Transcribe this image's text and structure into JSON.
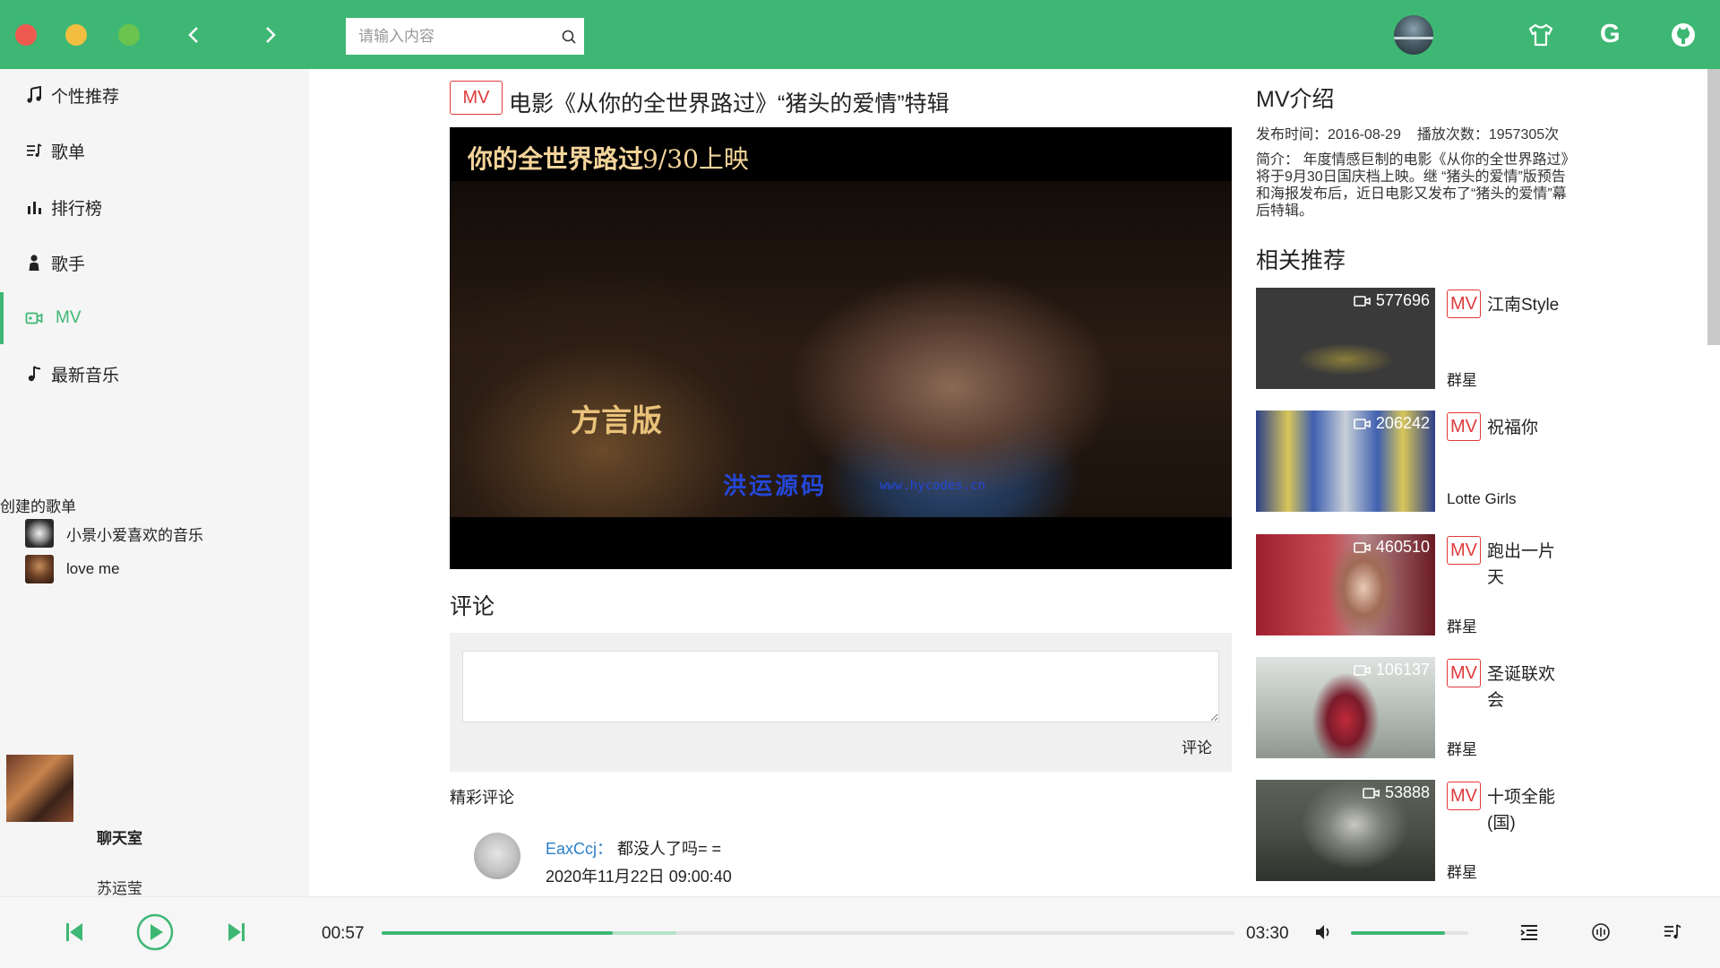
{
  "colors": {
    "accent": "#3eb774",
    "mv_tag": "#e03a3a",
    "link": "#2b7fc9"
  },
  "search": {
    "placeholder": "请输入内容"
  },
  "sidebar": {
    "nav": [
      {
        "label": "个性推荐",
        "icon": "music-note-icon"
      },
      {
        "label": "歌单",
        "icon": "playlist-icon"
      },
      {
        "label": "排行榜",
        "icon": "chart-bars-icon"
      },
      {
        "label": "歌手",
        "icon": "person-icon"
      },
      {
        "label": "MV",
        "icon": "video-camera-icon",
        "active": true
      },
      {
        "label": "最新音乐",
        "icon": "music-note-icon"
      }
    ],
    "created_title": "创建的歌单",
    "playlists": [
      {
        "name": "小景小爱喜欢的音乐"
      },
      {
        "name": "love me"
      }
    ],
    "now_playing": {
      "title": "聊天室",
      "artist": "苏运莹"
    }
  },
  "mv": {
    "tag": "MV",
    "title": "电影《从你的全世界路过》“猪头的爱情”特辑",
    "video_banner": "你的全世界路过",
    "video_date": "9/30上映",
    "video_side": "方言版",
    "watermark": "洪运源码",
    "watermark_url": "www.hycodes.cn"
  },
  "comments": {
    "title": "评论",
    "submit_label": "评论",
    "hot_title": "精彩评论",
    "items": [
      {
        "user": "EaxCcj：",
        "text": "都没人了吗= =",
        "time": "2020年11月22日 09:00:40"
      }
    ]
  },
  "intro": {
    "title": "MV介绍",
    "publish": "发布时间：2016-08-29",
    "plays": "播放次数：1957305次",
    "desc": "简介：  年度情感巨制的电影《从你的全世界路过》将于9月30日国庆档上映。继 “猪头的爱情”版预告和海报发布后，近日电影又发布了“猪头的爱情”幕后特辑。"
  },
  "related": {
    "title": "相关推荐",
    "tag": "MV",
    "items": [
      {
        "count": "577696",
        "name": "江南Style",
        "artist": "群星"
      },
      {
        "count": "206242",
        "name": "祝福你",
        "artist": "Lotte Girls"
      },
      {
        "count": "460510",
        "name": "跑出一片天",
        "artist": "群星"
      },
      {
        "count": "106137",
        "name": "圣诞联欢会",
        "artist": "群星"
      },
      {
        "count": "53888",
        "name": "十项全能(国)",
        "artist": "群星"
      }
    ]
  },
  "player": {
    "current_time": "00:57",
    "total_time": "03:30",
    "progress": 0.271,
    "buffered": 0.075,
    "volume": 0.8
  }
}
